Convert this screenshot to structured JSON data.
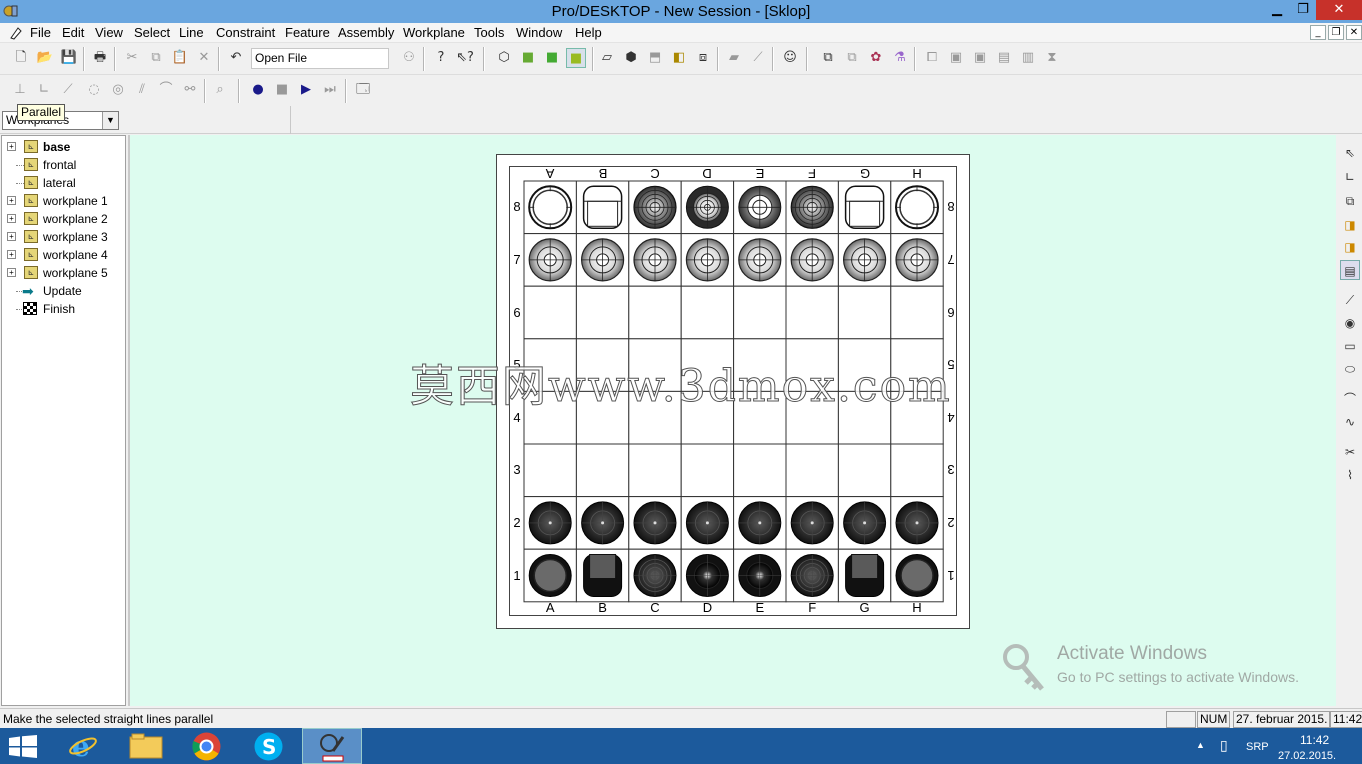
{
  "window": {
    "title": "Pro/DESKTOP - New Session - [Sklop]",
    "minimize": "▁",
    "restore": "❐",
    "close": "✕"
  },
  "menu": [
    "File",
    "Edit",
    "View",
    "Select",
    "Line",
    "Constraint",
    "Feature",
    "Assembly",
    "Workplane",
    "Tools",
    "Window",
    "Help"
  ],
  "mdi_controls": [
    "_",
    "❐",
    "✕"
  ],
  "toolbar": {
    "file_combo": "Open File"
  },
  "tooltip": "Parallel",
  "workplane_select": "Workplanes",
  "tree": {
    "items": [
      {
        "label": "base",
        "bold": true,
        "expandable": true,
        "icon": "workplane-icon"
      },
      {
        "label": "frontal",
        "bold": false,
        "expandable": false,
        "icon": "workplane-icon"
      },
      {
        "label": "lateral",
        "bold": false,
        "expandable": false,
        "icon": "workplane-icon"
      },
      {
        "label": "workplane 1",
        "bold": false,
        "expandable": true,
        "icon": "workplane-icon"
      },
      {
        "label": "workplane 2",
        "bold": false,
        "expandable": true,
        "icon": "workplane-icon"
      },
      {
        "label": "workplane 3",
        "bold": false,
        "expandable": true,
        "icon": "workplane-icon"
      },
      {
        "label": "workplane 4",
        "bold": false,
        "expandable": true,
        "icon": "workplane-icon"
      },
      {
        "label": "workplane 5",
        "bold": false,
        "expandable": true,
        "icon": "workplane-icon"
      },
      {
        "label": "Update",
        "bold": false,
        "expandable": false,
        "icon": "update-arrow-icon"
      },
      {
        "label": "Finish",
        "bold": false,
        "expandable": false,
        "icon": "checkered-flag-icon"
      }
    ]
  },
  "board": {
    "files": [
      "A",
      "B",
      "C",
      "D",
      "E",
      "F",
      "G",
      "H"
    ],
    "ranks": [
      "8",
      "7",
      "6",
      "5",
      "4",
      "3",
      "2",
      "1"
    ],
    "pieces": {
      "8": [
        "rook-w",
        "knight-w",
        "bishop-w",
        "queen-w",
        "king-w",
        "bishop-w",
        "knight-w",
        "rook-w"
      ],
      "7": [
        "pawn-w",
        "pawn-w",
        "pawn-w",
        "pawn-w",
        "pawn-w",
        "pawn-w",
        "pawn-w",
        "pawn-w"
      ],
      "2": [
        "pawn-b",
        "pawn-b",
        "pawn-b",
        "pawn-b",
        "pawn-b",
        "pawn-b",
        "pawn-b",
        "pawn-b"
      ],
      "1": [
        "rook-b",
        "knight-b",
        "bishop-b",
        "queen-b",
        "king-b",
        "bishop-b",
        "knight-b",
        "rook-b"
      ]
    }
  },
  "watermark": "莫西网www.3dmox.com",
  "activation": {
    "line1": "Activate Windows",
    "line2": "Go to PC settings to activate Windows."
  },
  "status": {
    "message": "Make the selected straight lines parallel",
    "num": "NUM",
    "date": "27. februar 2015.",
    "time": "11:42"
  },
  "taskbar": {
    "lang": "SRP",
    "time": "11:42",
    "date": "27.02.2015."
  },
  "colors": {
    "titlebar": "#6aa6df",
    "canvas": "#ddfcef",
    "taskbar": "#1c5a9c",
    "close": "#c7312a"
  }
}
